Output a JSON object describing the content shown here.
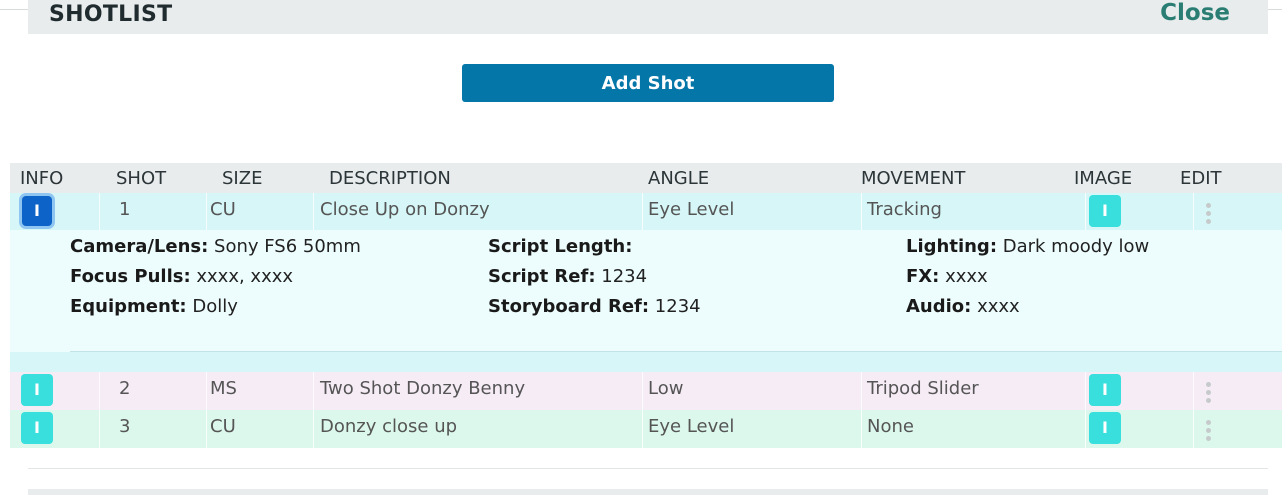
{
  "header": {
    "title": "SHOTLIST",
    "close_label": "Close"
  },
  "add_shot_label": "Add Shot",
  "columns": [
    "INFO",
    "SHOT",
    "SIZE",
    "DESCRIPTION",
    "ANGLE",
    "MOVEMENT",
    "IMAGE",
    "EDIT"
  ],
  "rows": [
    {
      "info": "I",
      "shot": "1",
      "size": "CU",
      "description": "Close Up on Donzy",
      "angle": "Eye Level",
      "movement": "Tracking",
      "image": "I",
      "color": "#d6f6f7",
      "expanded": true
    },
    {
      "info": "I",
      "shot": "2",
      "size": "MS",
      "description": "Two Shot Donzy Benny",
      "angle": "Low",
      "movement": "Tripod Slider",
      "image": "I",
      "color": "#f6ecf6"
    },
    {
      "info": "I",
      "shot": "3",
      "size": "CU",
      "description": "Donzy close up",
      "angle": "Eye Level",
      "movement": "None",
      "image": "I",
      "color": "#dcf8ec"
    }
  ],
  "details": {
    "camera_lens": {
      "label": "Camera/Lens:",
      "value": " Sony FS6 50mm"
    },
    "focus_pulls": {
      "label": "Focus Pulls:",
      "value": " xxxx, xxxx"
    },
    "equipment": {
      "label": "Equipment:",
      "value": " Dolly"
    },
    "script_length": {
      "label": "Script Length:",
      "value": ""
    },
    "script_ref": {
      "label": "Script Ref:",
      "value": " 1234"
    },
    "storyboard_ref": {
      "label": "Storyboard Ref:",
      "value": " 1234"
    },
    "lighting": {
      "label": "Lighting:",
      "value": " Dark moody low"
    },
    "fx": {
      "label": "FX:",
      "value": " xxxx"
    },
    "audio": {
      "label": "Audio:",
      "value": " xxxx"
    }
  },
  "icons": {
    "edit": "kebab-menu-icon"
  }
}
